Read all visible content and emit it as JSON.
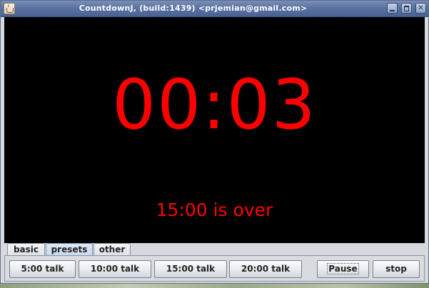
{
  "window": {
    "title": "CountdownJ, (build:1439) <prjemian@gmail.com>"
  },
  "display": {
    "time": "00:03",
    "message": "15:00 is over",
    "text_color": "#ff0000",
    "background_color": "#000000"
  },
  "tabs": [
    {
      "label": "basic",
      "selected": false
    },
    {
      "label": "presets",
      "selected": true
    },
    {
      "label": "other",
      "selected": false
    }
  ],
  "presets": {
    "buttons": [
      "5:00 talk",
      "10:00 talk",
      "15:00 talk",
      "20:00 talk"
    ],
    "pause_label": "Pause",
    "stop_label": "stop"
  },
  "icons": {
    "app": "java-cup-icon",
    "minimize": "minimize-icon",
    "maximize": "maximize-icon",
    "close": "close-icon"
  }
}
